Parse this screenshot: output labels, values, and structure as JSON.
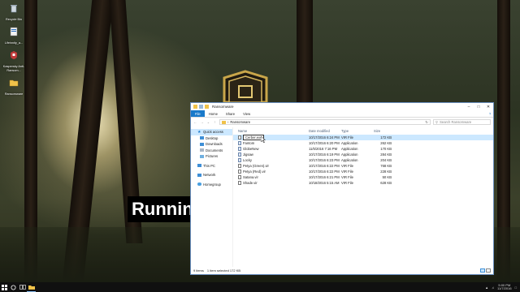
{
  "desktop": {
    "icons": [
      {
        "label": "Recycle Bin",
        "icon": "recycle-bin-icon"
      },
      {
        "label": "Lifeinnity_a...",
        "icon": "shortcut-icon"
      },
      {
        "label": "Kaspersky Anti-Ransom...",
        "icon": "kaspersky-icon"
      },
      {
        "label": "Ransomware",
        "icon": "folder-icon"
      }
    ],
    "overlay_text": "Running"
  },
  "explorer": {
    "title": "Ransomware",
    "ribbon_tabs": [
      "File",
      "Home",
      "Share",
      "View"
    ],
    "address": "Ransomware",
    "search_placeholder": "Search Ransomware",
    "nav": {
      "quick_access": "Quick access",
      "desktop": "Desktop",
      "downloads": "Downloads",
      "documents": "Documents",
      "pictures": "Pictures",
      "this_pc": "This PC",
      "network": "Network",
      "homegroup": "Homegroup"
    },
    "columns": {
      "name": "Name",
      "date": "Date modified",
      "type": "Type",
      "size": "Size"
    },
    "files": [
      {
        "name": "Cerber.exe",
        "date": "10/17/2016 6:24 PM",
        "type": "VIR File",
        "size": "172 KB",
        "icon": "file-icon",
        "selected": true
      },
      {
        "name": "Fantom",
        "date": "10/17/2016 6:20 PM",
        "type": "Application",
        "size": "262 KB",
        "icon": "app-icon"
      },
      {
        "name": "GlobeNew",
        "date": "11/5/2016 7:16 PM",
        "type": "Application",
        "size": "170 KB",
        "icon": "app-icon"
      },
      {
        "name": "Jigsaw",
        "date": "10/17/2016 6:19 PM",
        "type": "Application",
        "size": "284 KB",
        "icon": "app-icon"
      },
      {
        "name": "Locky",
        "date": "10/17/2016 6:23 PM",
        "type": "Application",
        "size": "204 KB",
        "icon": "app-icon"
      },
      {
        "name": "Petya (Green).vir",
        "date": "10/17/2016 6:22 PM",
        "type": "VIR File",
        "size": "768 KB",
        "icon": "file-icon"
      },
      {
        "name": "Petya (Red).vir",
        "date": "10/17/2016 6:22 PM",
        "type": "VIR File",
        "size": "228 KB",
        "icon": "file-icon"
      },
      {
        "name": "Satana.vir",
        "date": "10/17/2016 6:21 PM",
        "type": "VIR File",
        "size": "50 KB",
        "icon": "file-icon"
      },
      {
        "name": "Shade.vir",
        "date": "10/18/2016 5:15 AM",
        "type": "VIR File",
        "size": "628 KB",
        "icon": "file-icon"
      }
    ],
    "status": {
      "count": "9 items",
      "selection": "1 item selected 172 KB"
    }
  },
  "taskbar": {
    "time": "5:00 PM",
    "date": "11/7/2016"
  },
  "colors": {
    "accent": "#1979ca",
    "selection": "#cce8ff",
    "taskbar": "#101010"
  }
}
